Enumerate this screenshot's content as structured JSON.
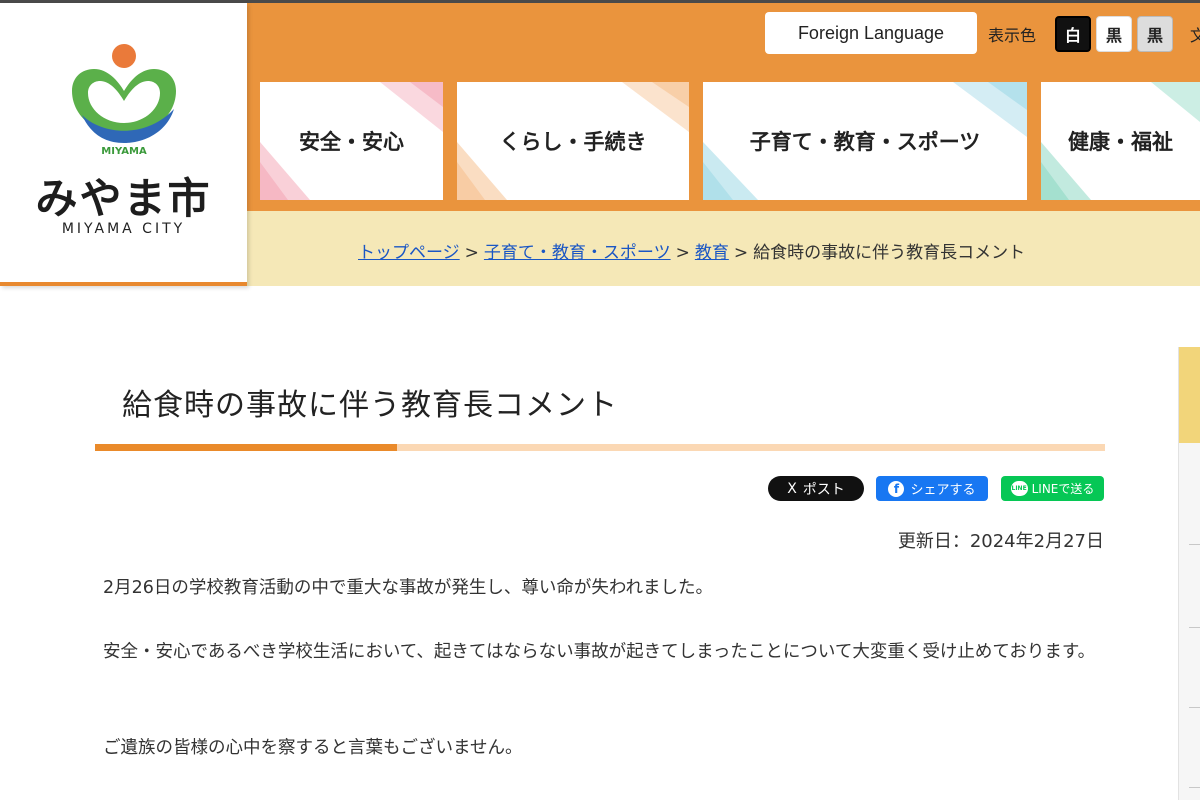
{
  "header": {
    "logo": {
      "mark_text": "MIYAMA",
      "name": "みやま市",
      "sub": "MIYAMA CITY"
    },
    "foreign_language_label": "Foreign Language",
    "display_color_label": "表示色",
    "color_options": [
      "白",
      "黒",
      "黒"
    ],
    "edge_char": "文",
    "nav": [
      {
        "label": "安全・安心",
        "accent": "#f4a9b8"
      },
      {
        "label": "くらし・手続き",
        "accent": "#f6c190"
      },
      {
        "label": "子育て・教育・スポーツ",
        "accent": "#9fd8e6"
      },
      {
        "label": "健康・福祉",
        "accent": "#8fd9c4"
      }
    ],
    "colors": {
      "orange": "#ea943d",
      "breadcrumb_bg": "#f5e8b7"
    }
  },
  "breadcrumb": {
    "items": [
      "トップページ",
      "子育て・教育・スポーツ",
      "教育"
    ],
    "current": "給食時の事故に伴う教育長コメント",
    "separator": ">"
  },
  "main": {
    "title": "給食時の事故に伴う教育長コメント",
    "share": {
      "x_label": "ポスト",
      "x_icon": "X",
      "facebook_label": "シェアする",
      "facebook_icon": "f",
      "line_label": "LINEで送る",
      "line_icon": "LINE"
    },
    "updated": "更新日：2024年2月27日",
    "paragraphs": [
      "2月26日の学校教育活動の中で重大な事故が発生し、尊い命が失われました。",
      "安全・安心であるべき学校生活において、起きてはならない事故が起きてしまったことについて大変重く受け止めております。",
      "ご遺族の皆様の心中を察すると言葉もございません。"
    ]
  }
}
